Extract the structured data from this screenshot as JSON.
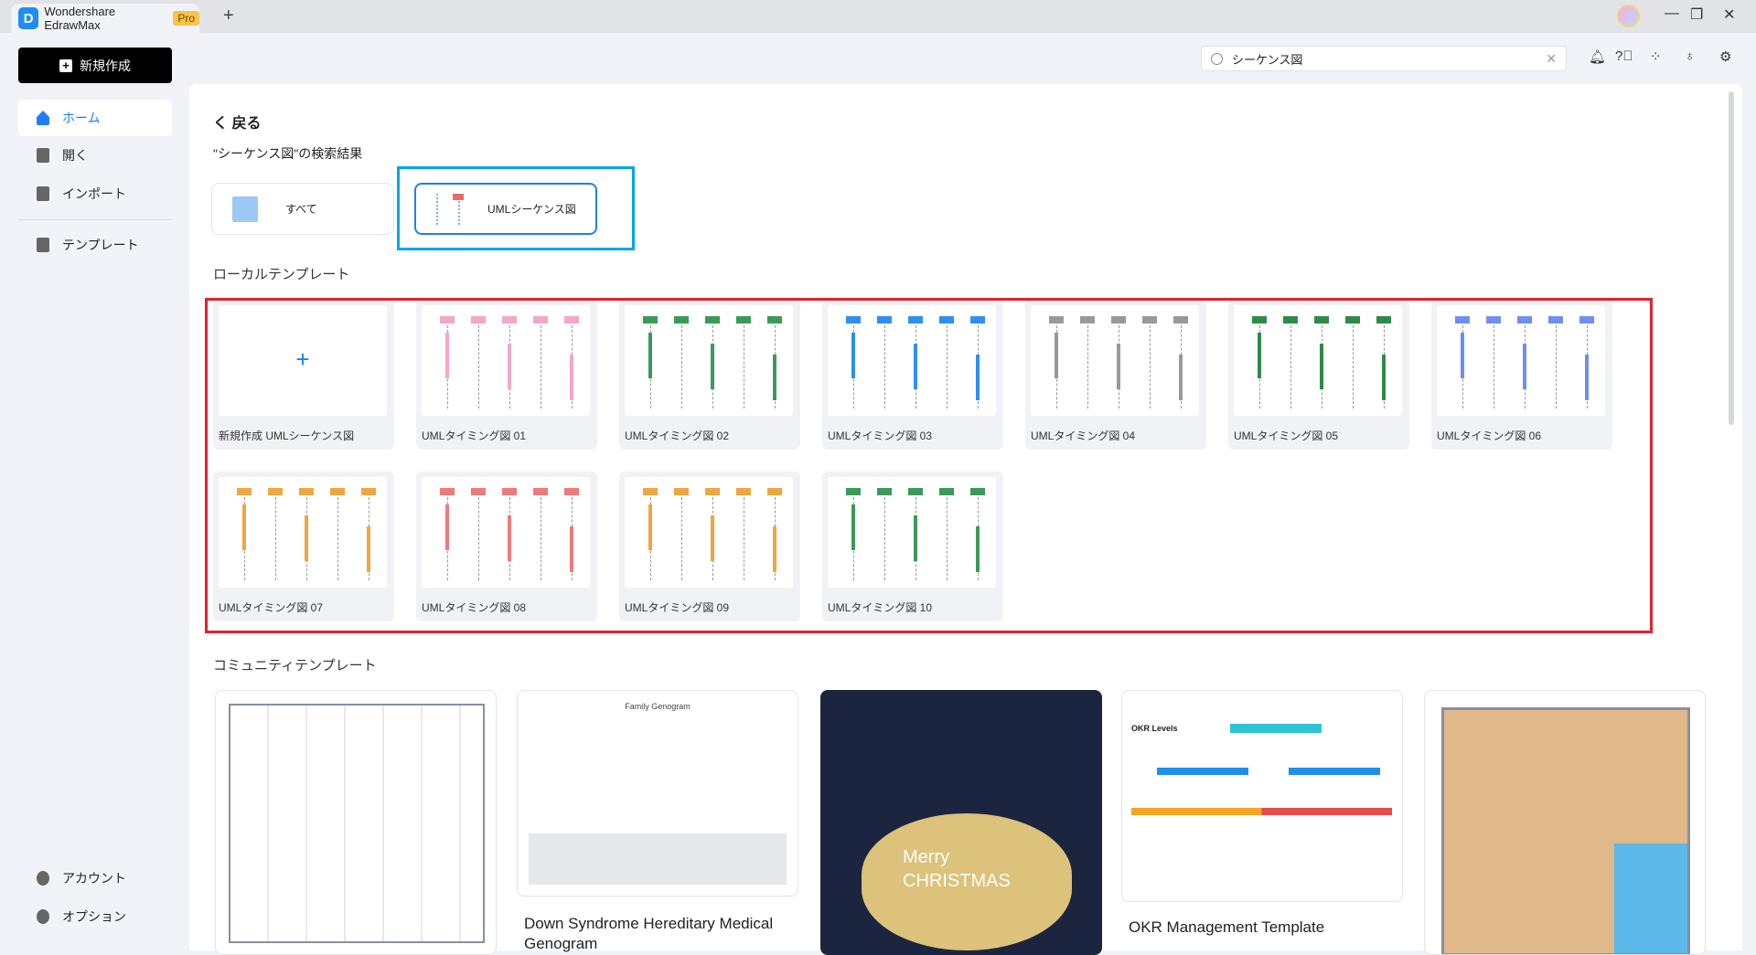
{
  "app": {
    "title": "Wondershare EdrawMax",
    "badge": "Pro",
    "new_tab": "+",
    "window": {
      "minimize": "—",
      "restore": "❐",
      "close": "✕"
    }
  },
  "sidebar": {
    "new_button": "新規作成",
    "items": [
      {
        "label": "ホーム",
        "icon": "home-icon",
        "active": true
      },
      {
        "label": "開く",
        "icon": "file-icon"
      },
      {
        "label": "インポート",
        "icon": "import-icon"
      },
      {
        "label": "テンプレート",
        "icon": "template-icon"
      }
    ],
    "bottom": [
      {
        "label": "アカウント",
        "icon": "account-icon"
      },
      {
        "label": "オプション",
        "icon": "gear-icon"
      }
    ]
  },
  "search": {
    "value": "シーケンス図",
    "clear": "✕"
  },
  "toolbar_icons": [
    "bell-icon",
    "help-icon",
    "apps-icon",
    "theme-icon",
    "settings-icon"
  ],
  "main": {
    "back": "く 戻る",
    "results_title": "\"シーケンス図\"の検索結果",
    "filters": [
      {
        "label": "すべて"
      },
      {
        "label": "UMLシーケンス図",
        "selected": true
      }
    ],
    "local_title": "ローカルテンプレート",
    "local_templates": [
      "新規作成 UMLシーケンス図",
      "UMLタイミング図 01",
      "UMLタイミング図 02",
      "UMLタイミング図 03",
      "UMLタイミング図 04",
      "UMLタイミング図 05",
      "UMLタイミング図 06",
      "UMLタイミング図 07",
      "UMLタイミング図 08",
      "UMLタイミング図 09",
      "UMLタイミング図 10"
    ],
    "community_title": "コミュニティテンプレート",
    "community_templates": [
      {
        "caption": ""
      },
      {
        "caption": "Down Syndrome Hereditary Medical Genogram",
        "thumb_title": "Family Genogram"
      },
      {
        "caption": "",
        "thumb_text": "Merry CHRISTMAS"
      },
      {
        "caption": "OKR Management Template",
        "thumb_title": "OKR Levels"
      },
      {
        "caption": ""
      }
    ]
  },
  "colors": {
    "accent": "#1e7ef5",
    "highlight_cyan": "#00a8e8",
    "highlight_red": "#e6202b",
    "pro": "#f8c34a"
  }
}
